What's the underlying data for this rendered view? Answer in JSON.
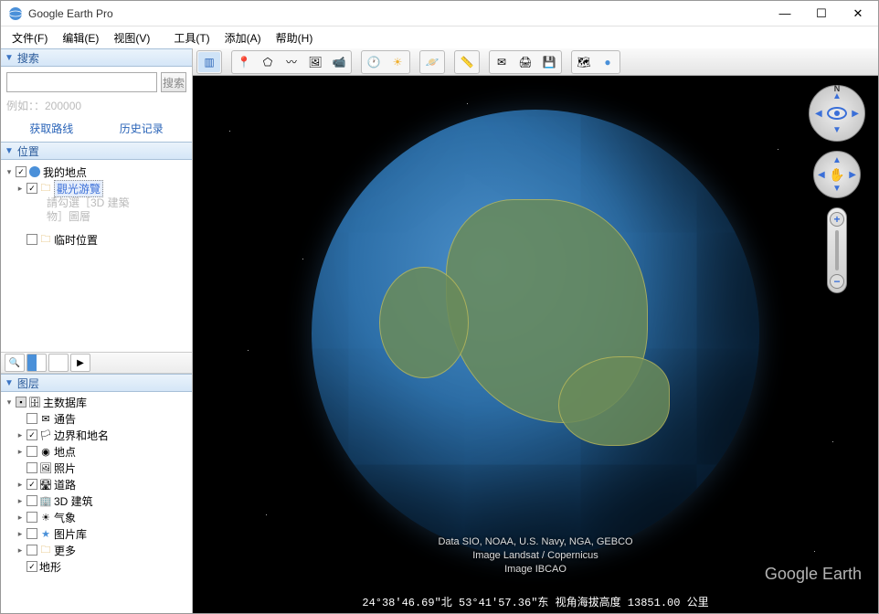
{
  "window": {
    "title": "Google Earth Pro"
  },
  "menu": {
    "file": "文件(F)",
    "edit": "编辑(E)",
    "view": "视图(V)",
    "tools": "工具(T)",
    "add": "添加(A)",
    "help": "帮助(H)"
  },
  "search": {
    "title": "搜索",
    "button": "搜索",
    "hint": "例如：：200000",
    "directions": "获取路线",
    "history": "历史记录"
  },
  "places": {
    "title": "位置",
    "my_places": "我的地点",
    "sightseeing": "觀光游覽",
    "hint1": "請勾選［3D 建築",
    "hint2": "物］圖層",
    "temp": "临时位置"
  },
  "layers": {
    "title": "图层",
    "primary": "主数据库",
    "items": [
      "通告",
      "边界和地名",
      "地点",
      "照片",
      "道路",
      "3D 建筑",
      "气象",
      "图片库",
      "更多",
      "地形"
    ]
  },
  "compass": {
    "n": "N"
  },
  "attrib": {
    "l1": "Data SIO, NOAA, U.S. Navy, NGA, GEBCO",
    "l2": "Image Landsat / Copernicus",
    "l3": "Image IBCAO"
  },
  "watermark": "Google Earth",
  "status": "24°38'46.69\"北  53°41'57.36\"东 视角海拔高度 13851.00 公里"
}
